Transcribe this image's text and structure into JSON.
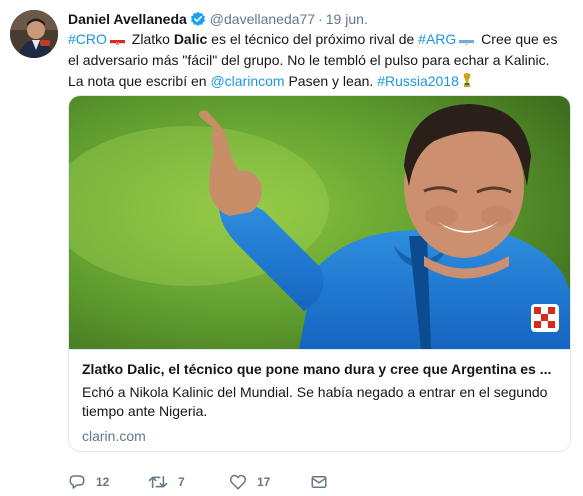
{
  "tweet": {
    "author_name": "Daniel Avellaneda",
    "author_handle": "@davellaneda77",
    "separator": "·",
    "date": "19 jun.",
    "text_parts": {
      "hashtag_cro": "#CRO",
      "t1": " Zlatko ",
      "dalic": "Dalic",
      "t2": " es el técnico del próximo rival de ",
      "hashtag_arg": "#ARG",
      "t3": " Cree que es el adversario más \"fácil\" del grupo. No le tembló el pulso para echar a Kalinic. La nota que escribí en ",
      "mention_clarin": "@clarincom",
      "t4": " Pasen y lean. ",
      "hashtag_rusia": "#Russia2018"
    }
  },
  "card": {
    "title": "Zlatko Dalic, el técnico que pone mano dura y cree que Argentina es ...",
    "description": "Echó a Nikola Kalinic del Mundial. Se había negado a entrar en el segundo tiempo ante Nigeria.",
    "domain": "clarin.com"
  },
  "actions": {
    "replies": "12",
    "retweets": "7",
    "likes": "17"
  },
  "colors": {
    "link": "#1b95e0",
    "muted": "#657786",
    "border": "#e1e8ed",
    "verified": "#1da1f2"
  },
  "icons": [
    "verified-badge-icon",
    "croatia-flag-icon",
    "argentina-flag-icon",
    "world-cup-trophy-icon",
    "reply-icon",
    "retweet-icon",
    "like-icon",
    "direct-message-icon"
  ]
}
